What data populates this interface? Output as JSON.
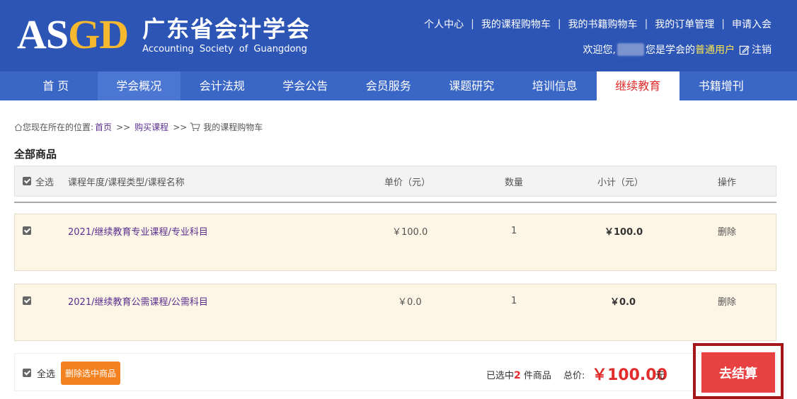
{
  "logo": {
    "mark_as": "AS",
    "mark_gd": "GD",
    "name_cn": "广东省会计学会",
    "name_en": "Accounting Society of Guangdong"
  },
  "top_links": [
    "个人中心",
    "我的课程购物车",
    "我的书籍购物车",
    "我的订单管理",
    "申请入会"
  ],
  "welcome": {
    "prefix": "欢迎您,",
    "middle": "您是学会的",
    "role": "普通用户",
    "logout": "注销"
  },
  "nav": [
    "首 页",
    "学会概况",
    "会计法规",
    "学会公告",
    "会员服务",
    "课题研究",
    "培训信息",
    "继续教育",
    "书籍增刊"
  ],
  "nav_active": "继续教育",
  "breadcrumb": {
    "prefix": "您现在所在的位置:",
    "home": "首页",
    "sep": ">>",
    "course": "购买课程",
    "current": "我的课程购物车"
  },
  "section_title": "全部商品",
  "table_header": {
    "select_all": "全选",
    "name": "课程年度/课程类型/课程名称",
    "price": "单价（元）",
    "qty": "数量",
    "subtotal": "小计（元）",
    "action": "操作"
  },
  "rows": [
    {
      "name": "2021/继续教育专业课程/专业科目",
      "price": "￥100.0",
      "qty": "1",
      "subtotal": "￥100.0",
      "action": "删除",
      "checked": true
    },
    {
      "name": "2021/继续教育公需课程/公需科目",
      "price": "￥0.0",
      "qty": "1",
      "subtotal": "￥0.0",
      "action": "删除",
      "checked": true
    }
  ],
  "footer": {
    "select_all": "全选",
    "delete_selected": "删除选中商品",
    "selected_prefix": "已选中",
    "selected_count": "2",
    "selected_suffix": " 件商品",
    "total_label": "总价:",
    "total_amount": "￥100.00",
    "total_unit": "元",
    "checkout": "去结算"
  },
  "colors": {
    "header_bg": "#2d55b5",
    "nav_bg": "#3a66c6",
    "accent_red": "#e22b2b",
    "logo_gold": "#f5b82e",
    "delete_btn": "#f58220",
    "row_bg": "#fdf5e6"
  }
}
